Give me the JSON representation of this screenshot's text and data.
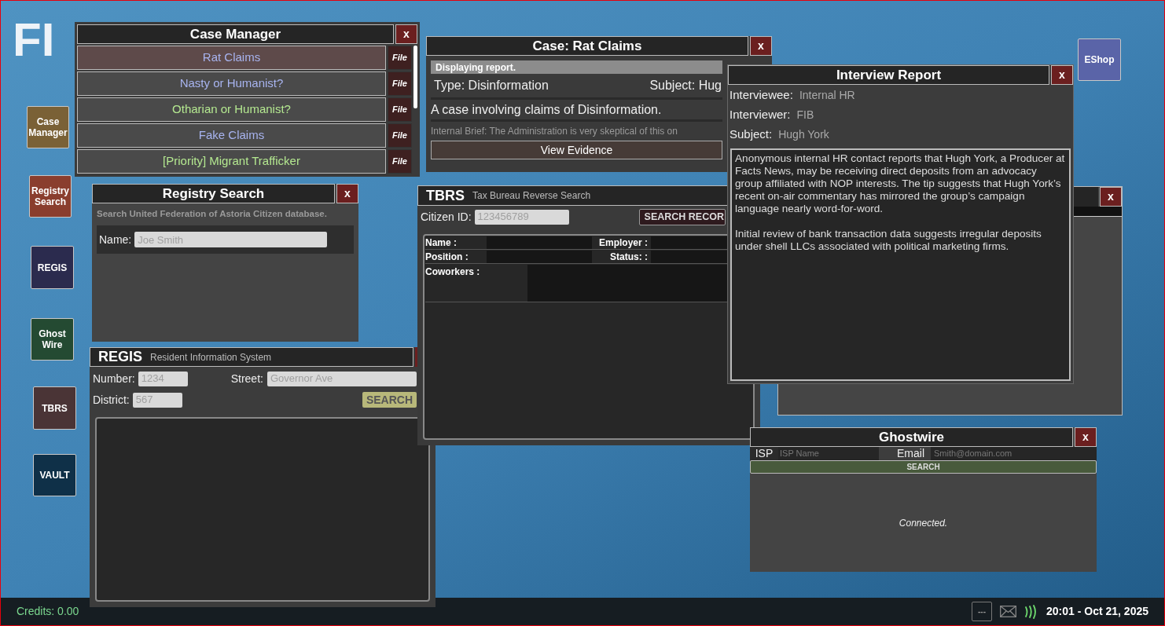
{
  "desktop": {
    "logo": "FI",
    "icons": [
      {
        "label": "Case Manager",
        "color": "#7a6136"
      },
      {
        "label": "Registry Search",
        "color": "#8a3e2e"
      },
      {
        "label": "REGIS",
        "color": "#2b2b4e"
      },
      {
        "label": "Ghost Wire",
        "color": "#244a32"
      },
      {
        "label": "TBRS",
        "color": "#4a3436"
      },
      {
        "label": "VAULT",
        "color": "#0f3048"
      },
      {
        "label": "EShop",
        "color": "#5a64a8"
      }
    ]
  },
  "case_manager": {
    "title": "Case Manager",
    "close": "x",
    "cases": [
      {
        "title": "Rat Claims",
        "color": "#a8b4f0",
        "selected": true,
        "file": "File"
      },
      {
        "title": "Nasty or Humanist?",
        "color": "#a8b4f0",
        "selected": false,
        "file": "File"
      },
      {
        "title": "Otharian or Humanist?",
        "color": "#b4e890",
        "selected": false,
        "file": "File"
      },
      {
        "title": "Fake Claims",
        "color": "#a8b4f0",
        "selected": false,
        "file": "File"
      },
      {
        "title": "[Priority] Migrant Trafficker",
        "color": "#b4e890",
        "selected": false,
        "file": "File"
      }
    ]
  },
  "case_window": {
    "title": "Case: Rat Claims",
    "close": "x",
    "status": "Displaying report.",
    "type": "Type: Disinformation",
    "subject": "Subject: Hug",
    "description": "A case involving claims of Disinformation.",
    "brief": "Internal Brief: The Administration is very skeptical of this on",
    "button": "View Evidence"
  },
  "registry_search": {
    "title": "Registry Search",
    "close": "x",
    "hint": "Search United Federation of Astoria Citizen database.",
    "name_label": "Name:",
    "name_placeholder": "Joe Smith"
  },
  "regis": {
    "title": "REGIS",
    "subtitle": "Resident Information System",
    "fields": [
      {
        "label": "Number:",
        "placeholder": "1234"
      },
      {
        "label": "Street:",
        "placeholder": "Governor Ave"
      },
      {
        "label": "District:",
        "placeholder": "567"
      }
    ],
    "search_button": "SEARCH"
  },
  "tbrs": {
    "title": "TBRS",
    "subtitle": "Tax Bureau Reverse Search",
    "citizen_label": "Citizen ID:",
    "citizen_placeholder": "123456789",
    "search_button": "SEARCH RECOR",
    "labels": [
      "Name :",
      "Employer :",
      "Position :",
      "Status: :",
      "Coworkers :"
    ]
  },
  "blank_window": {
    "close": "x"
  },
  "interview_report": {
    "title": "Interview Report",
    "close": "x",
    "fields": [
      {
        "label": "Interviewee:",
        "value": "Internal HR"
      },
      {
        "label": "Interviewer:",
        "value": "FIB"
      },
      {
        "label": "Subject:",
        "value": "Hugh York"
      }
    ],
    "paragraphs": [
      "Anonymous internal HR contact reports that Hugh York, a Producer at Facts News, may be receiving direct deposits from an advocacy group affiliated with NOP interests. The tip suggests that Hugh York’s recent on-air commentary has mirrored the group’s campaign language nearly word-for-word.",
      "Initial review of bank transaction data suggests irregular deposits under shell LLCs associated with political marketing firms."
    ]
  },
  "ghostwire": {
    "title": "Ghostwire",
    "close": "x",
    "isp_label": "ISP",
    "isp_placeholder": "ISP Name",
    "email_label": "Email",
    "email_placeholder": "Smith@domain.com",
    "search_button": "SEARCH",
    "status": "Connected."
  },
  "taskbar": {
    "credits": "Credits: 0.00",
    "more": "---",
    "clock": "20:01 - Oct 21, 2025"
  }
}
